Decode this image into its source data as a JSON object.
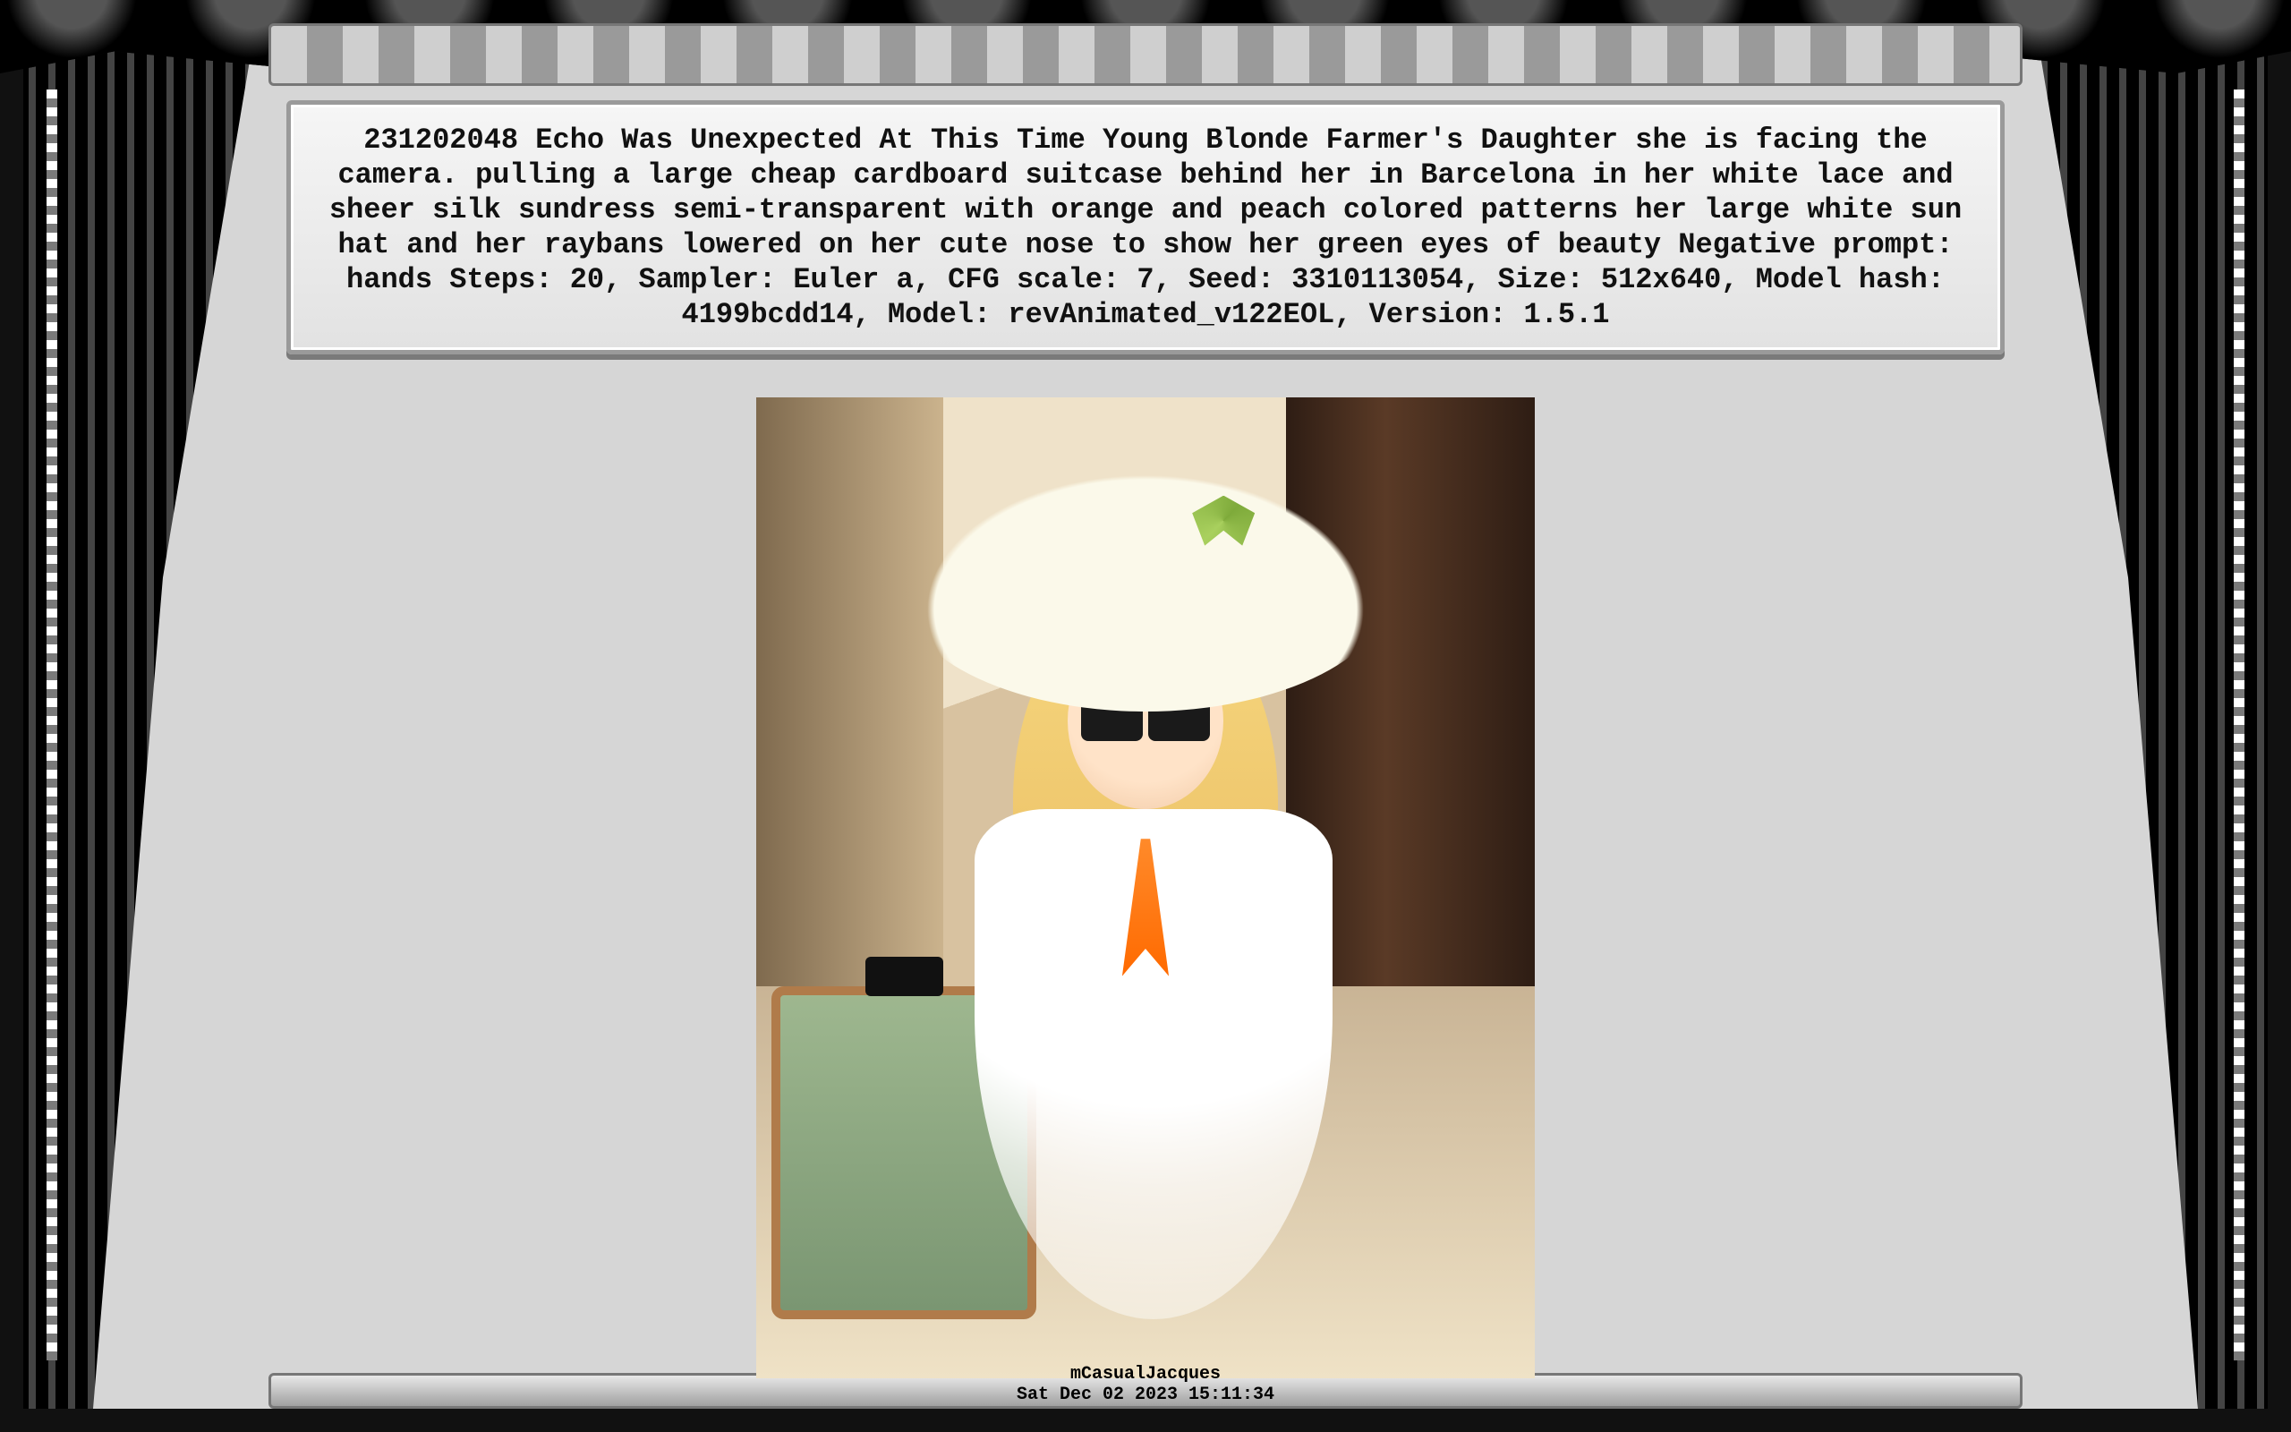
{
  "panel": {
    "text": "231202048 Echo Was Unexpected At This Time Young Blonde Farmer's Daughter she is facing the camera. pulling a large cheap cardboard suitcase behind her in Barcelona in her white lace and sheer silk sundress semi-transparent with orange and peach colored patterns her large white sun hat and her raybans lowered on her cute nose to show her green eyes of beauty  Negative prompt: hands Steps: 20, Sampler: Euler a, CFG scale: 7, Seed: 3310113054, Size: 512x640, Model hash: 4199bcdd14, Model: revAnimated_v122EOL, Version: 1.5.1"
  },
  "caption": {
    "author": "mCasualJacques",
    "timestamp": "Sat Dec 02 2023 15:11:34"
  }
}
